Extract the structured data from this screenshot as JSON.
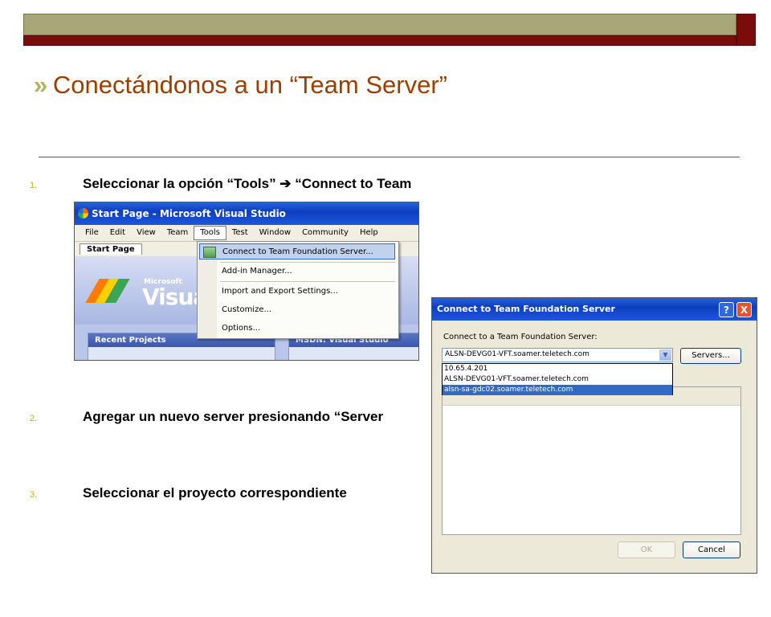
{
  "slide": {
    "title": "Conectándonos a un “Team Server”",
    "chevron": "»"
  },
  "steps": [
    {
      "num": "1.",
      "text": "Seleccionar la opción “Tools”  ➔ “Connect to Team"
    },
    {
      "num": "2.",
      "text": "Agregar un nuevo server presionando “Server"
    },
    {
      "num": "3.",
      "text": "Seleccionar el proyecto correspondiente"
    }
  ],
  "vs": {
    "window_title": "Start Page - Microsoft Visual Studio",
    "menu": [
      "File",
      "Edit",
      "View",
      "Team",
      "Tools",
      "Test",
      "Window",
      "Community",
      "Help"
    ],
    "active_menu": "Tools",
    "tab": "Start Page",
    "brand_small": "Microsoft",
    "brand_big": "Visua",
    "tools_menu": [
      "Connect to Team Foundation Server...",
      "Add-in Manager...",
      "Import and Export Settings...",
      "Customize...",
      "Options..."
    ],
    "panel_left": "Recent Projects",
    "panel_right": "MSDN: Visual Studio"
  },
  "dialog": {
    "title": "Connect to Team Foundation Server",
    "help_icon": "?",
    "close_icon": "X",
    "label": "Connect to a Team Foundation Server:",
    "selected_server": "ALSN-DEVG01-VFT.soamer.teletech.com",
    "servers_button": "Servers...",
    "options": [
      "10.65.4.201",
      "ALSN-DEVG01-VFT.soamer.teletech.com",
      "alsn-sa-gdc02.soamer.teletech.com"
    ],
    "ok_label": "OK",
    "cancel_label": "Cancel"
  },
  "colors": {
    "title_text": "#9a3f00",
    "accent_olive": "#a7a777",
    "accent_maroon": "#7a0c0c",
    "xp_blue": "#0b3fc0"
  }
}
